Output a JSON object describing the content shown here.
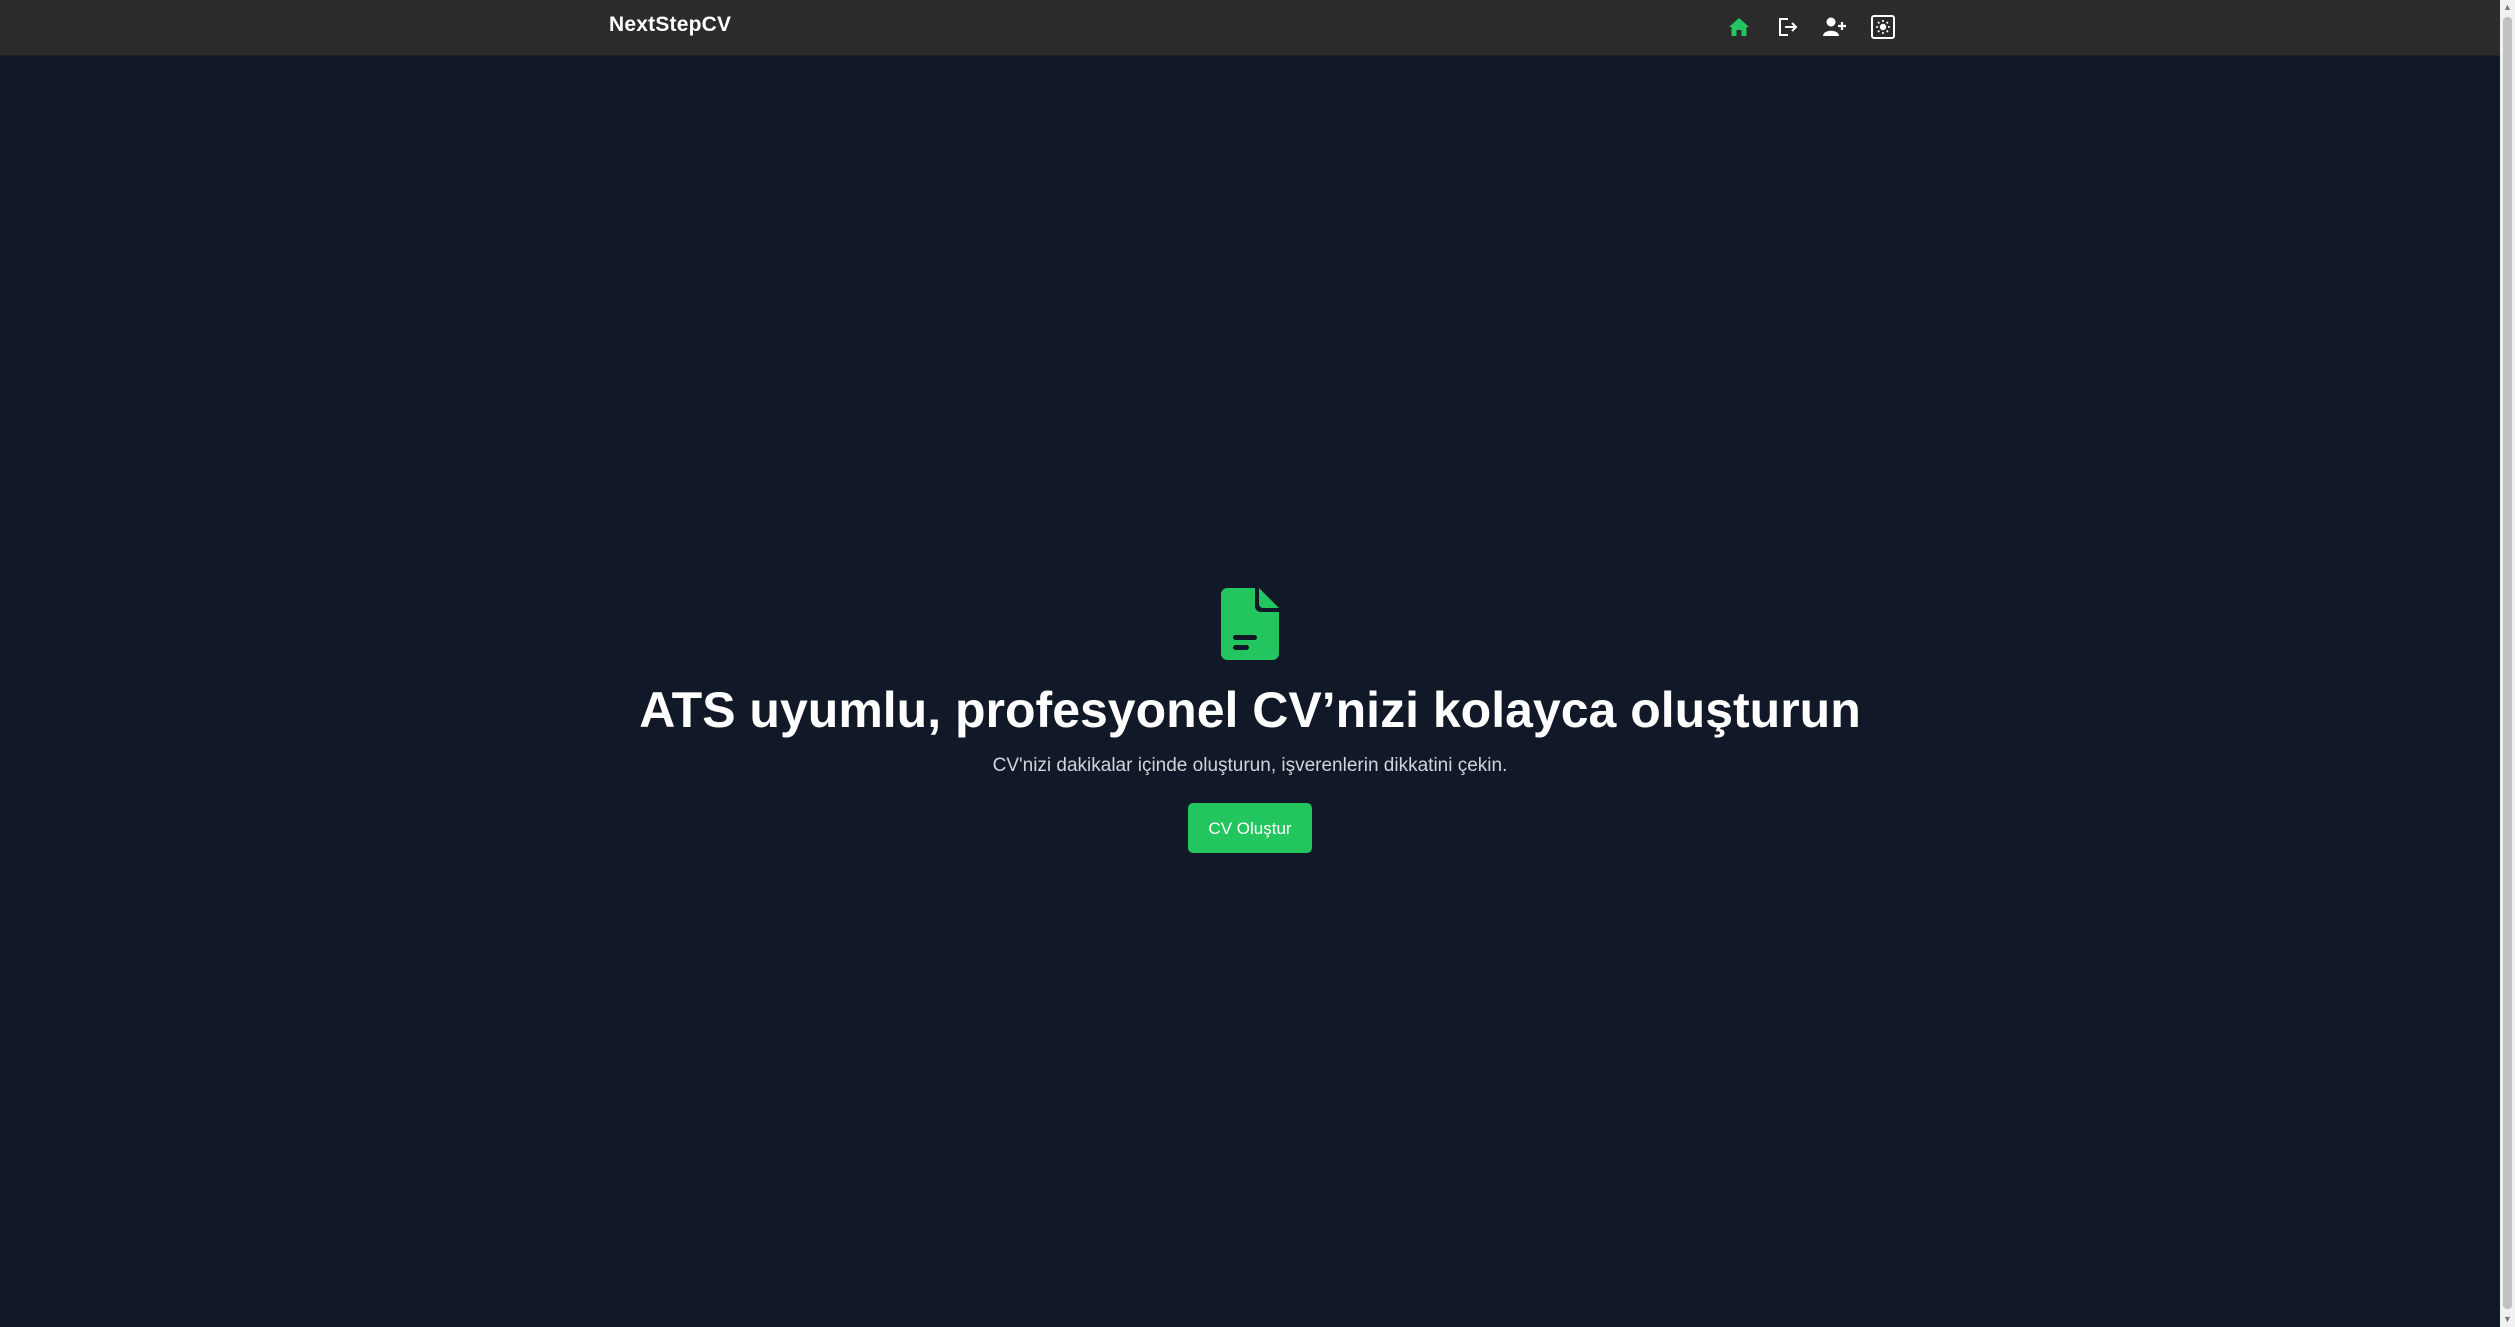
{
  "header": {
    "brand": "NextStepCV",
    "icons": [
      {
        "name": "home-icon",
        "color": "#22c55e"
      },
      {
        "name": "logout-icon",
        "color": "#ffffff"
      },
      {
        "name": "add-user-icon",
        "color": "#ffffff"
      },
      {
        "name": "theme-toggle-icon",
        "color": "#ffffff"
      }
    ]
  },
  "hero": {
    "icon": "document-icon",
    "title": "ATS uyumlu, profesyonel CV’nizi kolayca oluşturun",
    "subtitle": "CV'nizi dakikalar içinde oluşturun, işverenlerin dikkatini çekin.",
    "cta_label": "CV Oluştur"
  },
  "colors": {
    "background": "#111827",
    "navbar": "#2b2b2b",
    "accent": "#22c55e"
  }
}
